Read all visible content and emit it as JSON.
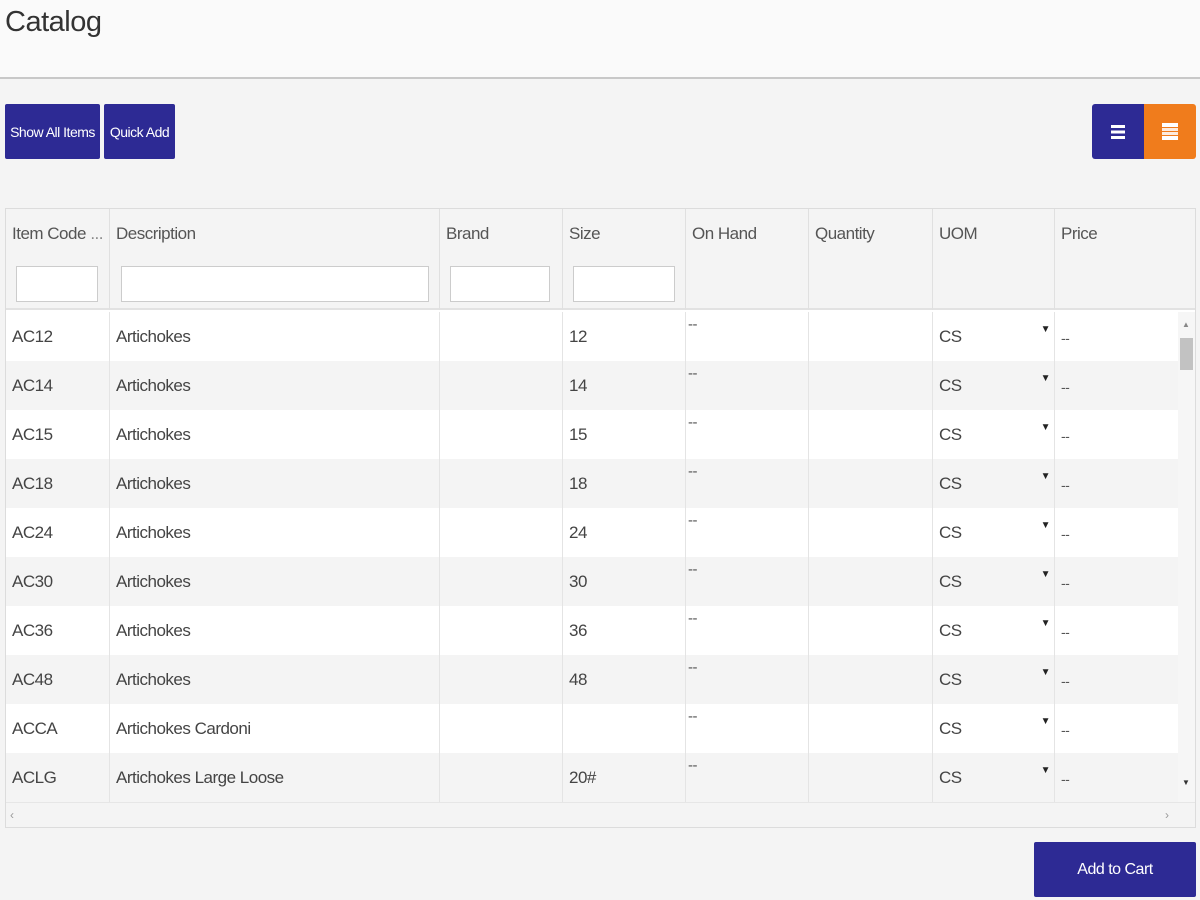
{
  "page": {
    "title": "Catalog"
  },
  "toolbar": {
    "show_all_label": "Show All Items",
    "quick_add_label": "Quick Add"
  },
  "table": {
    "columns": [
      {
        "label": "Item Code",
        "has_filter": true
      },
      {
        "label": "Description",
        "has_filter": true
      },
      {
        "label": "Brand",
        "has_filter": true
      },
      {
        "label": "Size",
        "has_filter": true
      },
      {
        "label": "On Hand",
        "has_filter": false
      },
      {
        "label": "Quantity",
        "has_filter": false
      },
      {
        "label": "UOM",
        "has_filter": false
      },
      {
        "label": "Price",
        "has_filter": false
      }
    ],
    "item_code_menu": "...",
    "rows": [
      {
        "code": "AC12",
        "desc": "Artichokes",
        "brand": "",
        "size": "12",
        "on_hand": "--",
        "qty": "",
        "uom": "CS",
        "price": "--"
      },
      {
        "code": "AC14",
        "desc": "Artichokes",
        "brand": "",
        "size": "14",
        "on_hand": "--",
        "qty": "",
        "uom": "CS",
        "price": "--"
      },
      {
        "code": "AC15",
        "desc": "Artichokes",
        "brand": "",
        "size": "15",
        "on_hand": "--",
        "qty": "",
        "uom": "CS",
        "price": "--"
      },
      {
        "code": "AC18",
        "desc": "Artichokes",
        "brand": "",
        "size": "18",
        "on_hand": "--",
        "qty": "",
        "uom": "CS",
        "price": "--"
      },
      {
        "code": "AC24",
        "desc": "Artichokes",
        "brand": "",
        "size": "24",
        "on_hand": "--",
        "qty": "",
        "uom": "CS",
        "price": "--"
      },
      {
        "code": "AC30",
        "desc": "Artichokes",
        "brand": "",
        "size": "30",
        "on_hand": "--",
        "qty": "",
        "uom": "CS",
        "price": "--"
      },
      {
        "code": "AC36",
        "desc": "Artichokes",
        "brand": "",
        "size": "36",
        "on_hand": "--",
        "qty": "",
        "uom": "CS",
        "price": "--"
      },
      {
        "code": "AC48",
        "desc": "Artichokes",
        "brand": "",
        "size": "48",
        "on_hand": "--",
        "qty": "",
        "uom": "CS",
        "price": "--"
      },
      {
        "code": "ACCA",
        "desc": "Artichokes Cardoni",
        "brand": "",
        "size": "",
        "on_hand": "--",
        "qty": "",
        "uom": "CS",
        "price": "--"
      },
      {
        "code": "ACLG",
        "desc": "Artichokes Large Loose",
        "brand": "",
        "size": "20#",
        "on_hand": "--",
        "qty": "",
        "uom": "CS",
        "price": "--"
      }
    ]
  },
  "footer": {
    "add_to_cart_label": "Add to Cart"
  },
  "colors": {
    "primary": "#2d2a94",
    "accent": "#f07c1c"
  },
  "icons": {
    "list_view": "list-view-icon",
    "grid_view": "grid-view-icon"
  }
}
